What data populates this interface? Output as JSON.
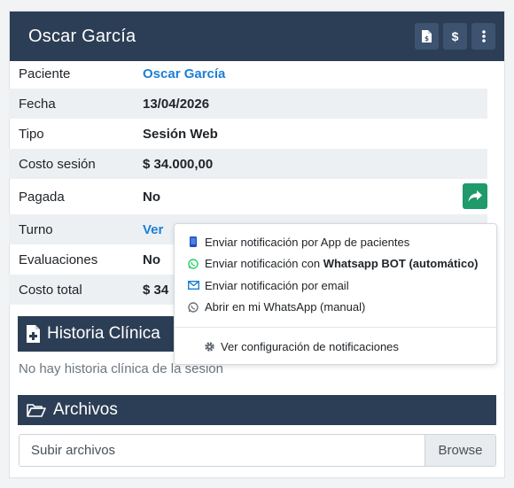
{
  "header": {
    "title": "Oscar García"
  },
  "rows": [
    {
      "label": "Paciente",
      "value": "Oscar García"
    },
    {
      "label": "Fecha",
      "value": "13/04/2026"
    },
    {
      "label": "Tipo",
      "value": "Sesión Web"
    },
    {
      "label": "Costo sesión",
      "value": "$ 34.000,00"
    },
    {
      "label": "Pagada",
      "value": "No"
    },
    {
      "label": "Turno",
      "value": "Ver"
    },
    {
      "label": "Evaluaciones",
      "value": "No"
    },
    {
      "label": "Costo total",
      "value": "$ 34"
    }
  ],
  "historia": {
    "title": "Historia Clínica",
    "empty": "No hay historia clínica de la sesión"
  },
  "archivos": {
    "title": "Archivos",
    "placeholder": "Subir archivos",
    "browse": "Browse"
  },
  "menu": {
    "app": "Enviar notificación por App de pacientes",
    "whatsapp_prefix": "Enviar notificación con ",
    "whatsapp_bold": "Whatsapp BOT (automático)",
    "email": "Enviar notificación por email",
    "whatsapp_manual": "Abrir en mi WhatsApp (manual)",
    "config": "Ver configuración de notificaciones"
  },
  "colors": {
    "header": "#2c3e55",
    "link": "#1b7fd6",
    "share": "#1e9a6b",
    "whatsapp": "#25d366",
    "email": "#1b7fd6"
  },
  "icons": [
    "invoice-icon",
    "dollar-icon",
    "more-vertical-icon",
    "share-icon",
    "file-medical-icon",
    "folder-open-icon",
    "mobile-icon",
    "whatsapp-icon",
    "envelope-icon",
    "gear-icon"
  ]
}
